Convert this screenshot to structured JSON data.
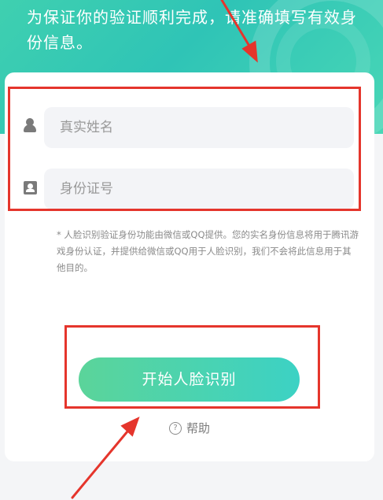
{
  "header": {
    "message": "为保证你的验证顺利完成，请准确填写有效身份信息。"
  },
  "form": {
    "name_placeholder": "真实姓名",
    "id_placeholder": "身份证号",
    "name_icon": "person-icon",
    "id_icon": "id-card-icon"
  },
  "notice": {
    "text": "* 人脸识别验证身份功能由微信或QQ提供。您的实名身份信息将用于腾讯游戏身份认证，并提供给微信或QQ用于人脸识别，我们不会将此信息用于其他目的。"
  },
  "actions": {
    "start_label": "开始人脸识别",
    "help_label": "帮助",
    "help_icon_glyph": "?"
  },
  "annotations": {
    "highlight_color": "#e5352c"
  },
  "colors": {
    "hero_gradient": [
      "#3fd0b0",
      "#49d7b6"
    ],
    "button_gradient": [
      "#5bd49a",
      "#3cd2c4"
    ]
  }
}
